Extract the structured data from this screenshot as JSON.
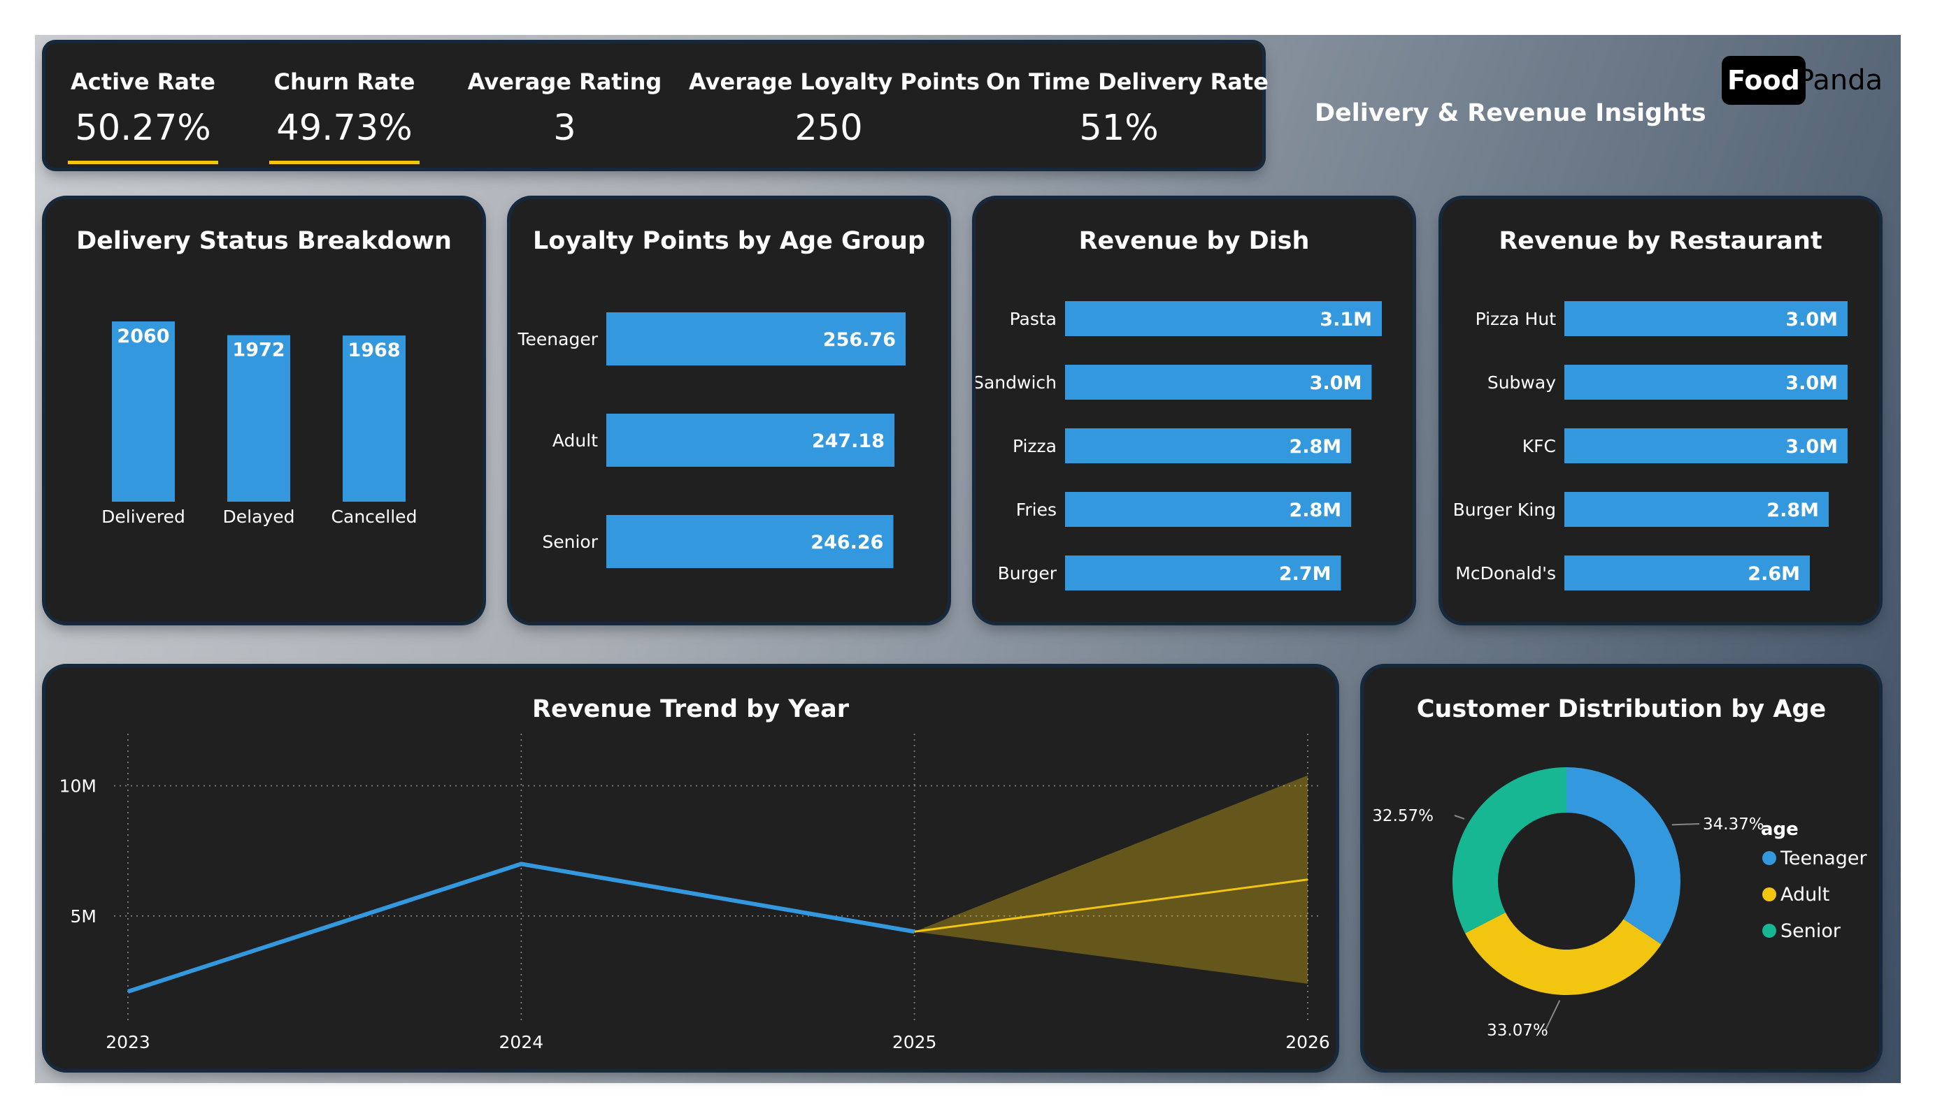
{
  "header": {
    "title": "Delivery & Revenue Insights",
    "logo_food": "Food",
    "logo_panda": "Panda",
    "accent_color": "#f2c511"
  },
  "kpis": [
    {
      "label": "Active Rate",
      "value": "50.27%"
    },
    {
      "label": "Churn Rate",
      "value": "49.73%"
    },
    {
      "label": "Average Rating",
      "value": "3"
    },
    {
      "label": "Average Loyalty Points",
      "value": "250"
    },
    {
      "label": "On Time Delivery Rate",
      "value": "51%"
    }
  ],
  "chart_data": [
    {
      "id": "delivery",
      "type": "bar",
      "title": "Delivery Status Breakdown",
      "categories": [
        "Delivered",
        "Delayed",
        "Cancelled"
      ],
      "values": [
        2060,
        1972,
        1968
      ],
      "color": "#3398dd"
    },
    {
      "id": "loyalty",
      "type": "bar",
      "orientation": "horizontal",
      "title": "Loyalty Points by Age Group",
      "categories": [
        "Teenager",
        "Adult",
        "Senior"
      ],
      "values": [
        256.76,
        247.18,
        246.26
      ],
      "labels": [
        "256.76",
        "247.18",
        "246.26"
      ],
      "color": "#3398dd"
    },
    {
      "id": "dish",
      "type": "bar",
      "orientation": "horizontal",
      "title": "Revenue by Dish",
      "categories": [
        "Pasta",
        "Sandwich",
        "Pizza",
        "Fries",
        "Burger"
      ],
      "values": [
        3.1,
        3.0,
        2.8,
        2.8,
        2.7
      ],
      "labels": [
        "3.1M",
        "3.0M",
        "2.8M",
        "2.8M",
        "2.7M"
      ],
      "color": "#3398dd"
    },
    {
      "id": "restaurant",
      "type": "bar",
      "orientation": "horizontal",
      "title": "Revenue by Restaurant",
      "categories": [
        "Pizza Hut",
        "Subway",
        "KFC",
        "Burger King",
        "McDonald's"
      ],
      "values": [
        3.0,
        3.0,
        3.0,
        2.8,
        2.6
      ],
      "labels": [
        "3.0M",
        "3.0M",
        "3.0M",
        "2.8M",
        "2.6M"
      ],
      "color": "#3398dd"
    },
    {
      "id": "trend",
      "type": "line",
      "title": "Revenue Trend by Year",
      "x": [
        2023,
        2024,
        2025,
        2026
      ],
      "xticks": [
        "2023",
        "2024",
        "2025",
        "2026"
      ],
      "yticks": [
        5,
        10
      ],
      "ytick_labels": [
        "5M",
        "10M"
      ],
      "ylim": [
        1,
        12
      ],
      "series": [
        {
          "values": [
            2.1,
            7.0,
            4.4
          ],
          "color": "#3398dd"
        }
      ],
      "forecast": {
        "x": [
          2025,
          2026
        ],
        "values": [
          4.4,
          6.4
        ],
        "upper": [
          4.4,
          10.4
        ],
        "lower": [
          4.4,
          2.4
        ],
        "color": "#f2c511"
      },
      "grid": true
    },
    {
      "id": "age",
      "type": "pie",
      "title": "Customer Distribution by Age",
      "legend_title": "age",
      "legend_position": "right",
      "slices": [
        {
          "name": "Teenager",
          "value": 34.37,
          "label": "34.37%",
          "color": "#3398dd"
        },
        {
          "name": "Adult",
          "value": 33.07,
          "label": "33.07%",
          "color": "#f2c511"
        },
        {
          "name": "Senior",
          "value": 32.57,
          "label": "32.57%",
          "color": "#17b793"
        }
      ]
    }
  ]
}
